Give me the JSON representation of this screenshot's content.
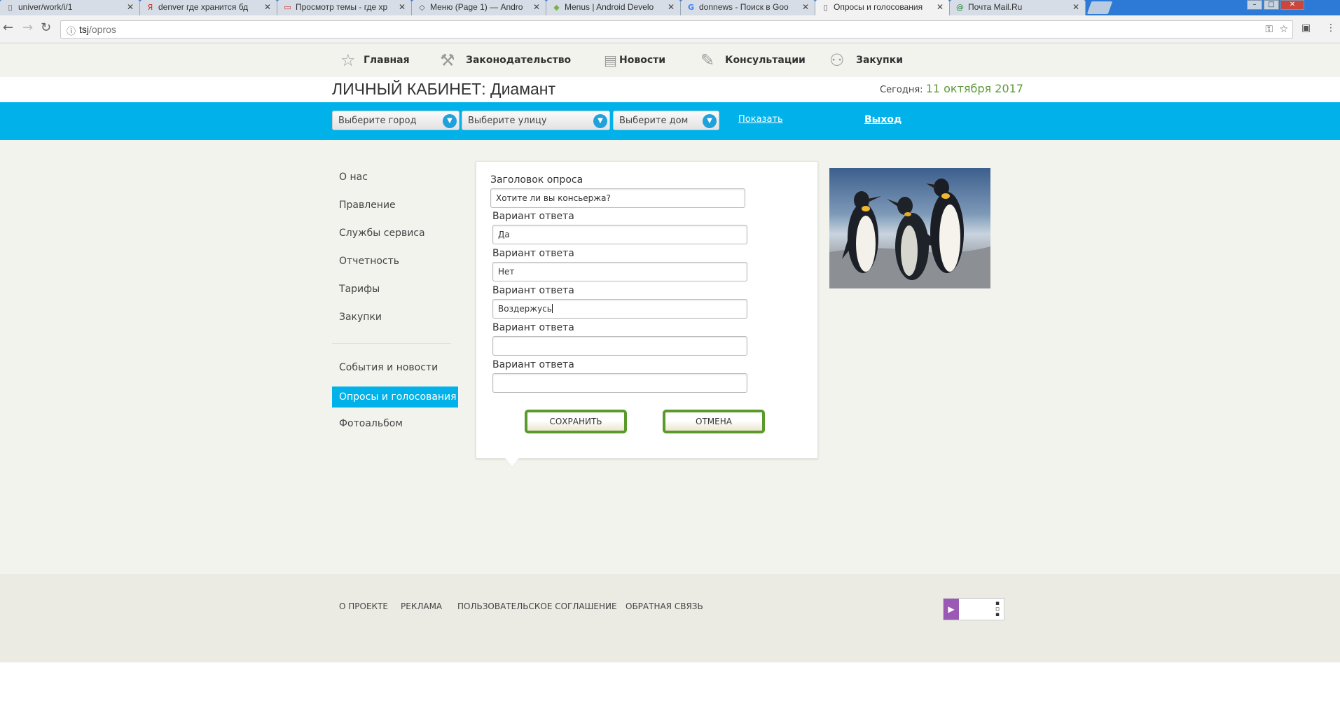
{
  "browser": {
    "tabs": [
      {
        "icon": "document-icon",
        "label": "univer/work/i/1",
        "active": false
      },
      {
        "icon": "yandex-icon",
        "label": "denver где хранится бд",
        "active": false
      },
      {
        "icon": "forum-icon",
        "label": "Просмотр темы - где хр",
        "active": false
      },
      {
        "icon": "android-icon",
        "label": "Меню (Page 1) — Andro",
        "active": false
      },
      {
        "icon": "android-robot-icon",
        "label": "Menus | Android Develo",
        "active": false
      },
      {
        "icon": "google-icon",
        "label": "donnews - Поиск в Goo",
        "active": false
      },
      {
        "icon": "document-icon",
        "label": "Опросы и голосования",
        "active": true
      },
      {
        "icon": "mailru-icon",
        "label": "Почта Mail.Ru",
        "active": false
      }
    ],
    "url_host": "tsj",
    "url_path": "/opros"
  },
  "nav": {
    "items": [
      {
        "icon": "star-icon",
        "label": "Главная"
      },
      {
        "icon": "gavel-icon",
        "label": "Законодательство"
      },
      {
        "icon": "newspaper-icon",
        "label": "Новости"
      },
      {
        "icon": "chat-bubble-icon",
        "label": "Консультации"
      },
      {
        "icon": "people-icon",
        "label": "Закупки"
      }
    ]
  },
  "header": {
    "title": "ЛИЧНЫЙ КАБИНЕТ: Диамант",
    "today_label": "Сегодня:",
    "today_date": "11 октября 2017"
  },
  "filters": {
    "city_placeholder": "Выберите город",
    "street_placeholder": "Выберите улицу",
    "house_placeholder": "Выберите дом",
    "show_link": "Показать",
    "logout_link": "Выход"
  },
  "sidebar": {
    "items": [
      {
        "label": "О нас",
        "active": false
      },
      {
        "label": "Правление",
        "active": false
      },
      {
        "label": "Службы сервиса",
        "active": false
      },
      {
        "label": "Отчетность",
        "active": false
      },
      {
        "label": "Тарифы",
        "active": false
      },
      {
        "label": "Закупки",
        "active": false
      },
      {
        "label": "События и новости",
        "active": false
      },
      {
        "label": "Опросы и голосования",
        "active": true
      },
      {
        "label": "Фотоальбом",
        "active": false
      }
    ]
  },
  "form": {
    "title_label": "Заголовок опроса",
    "title_value": "Хотите ли вы консьержа?",
    "answer_label": "Вариант ответа",
    "answers": [
      "Да",
      "Нет",
      "Воздержусь",
      "",
      ""
    ],
    "save_label": "СОХРАНИТЬ",
    "cancel_label": "ОТМЕНА"
  },
  "footer": {
    "links": [
      "О ПРОЕКТЕ",
      "РЕКЛАМА",
      "ПОЛЬЗОВАТЕЛЬСКОЕ СОГЛАШЕНИЕ",
      "ОБРАТНАЯ СВЯЗЬ"
    ]
  },
  "colors": {
    "accent": "#00b1ea",
    "button_border": "#5a9a2a",
    "date_green": "#5e9b3a"
  }
}
